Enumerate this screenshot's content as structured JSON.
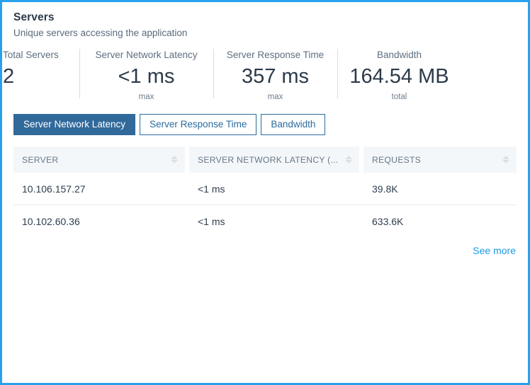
{
  "panel": {
    "title": "Servers",
    "subtitle": "Unique servers accessing the application",
    "accent_color": "#29a0ec",
    "active_tab_color": "#31699b",
    "link_color": "#1b9ae5"
  },
  "stats": [
    {
      "label": "Total Servers",
      "value": "2",
      "sub": ""
    },
    {
      "label": "Server Network Latency",
      "value": "<1 ms",
      "sub": "max"
    },
    {
      "label": "Server Response Time",
      "value": "357 ms",
      "sub": "max"
    },
    {
      "label": "Bandwidth",
      "value": "164.54 MB",
      "sub": "total"
    }
  ],
  "tabs": [
    {
      "label": "Server Network Latency",
      "active": true
    },
    {
      "label": "Server Response Time",
      "active": false
    },
    {
      "label": "Bandwidth",
      "active": false
    }
  ],
  "table": {
    "columns": [
      {
        "label": "SERVER",
        "sortable": true,
        "sort_icon": "sort-arrows-icon"
      },
      {
        "label": "SERVER NETWORK LATENCY (...",
        "sortable": true,
        "sort_icon": "sort-arrows-icon"
      },
      {
        "label": "REQUESTS",
        "sortable": true,
        "sort_icon": "sort-arrows-icon"
      }
    ],
    "rows": [
      {
        "server": "10.106.157.27",
        "latency": "<1 ms",
        "requests": "39.8K"
      },
      {
        "server": "10.102.60.36",
        "latency": "<1 ms",
        "requests": "633.6K"
      }
    ]
  },
  "footer": {
    "see_more_label": "See more"
  }
}
